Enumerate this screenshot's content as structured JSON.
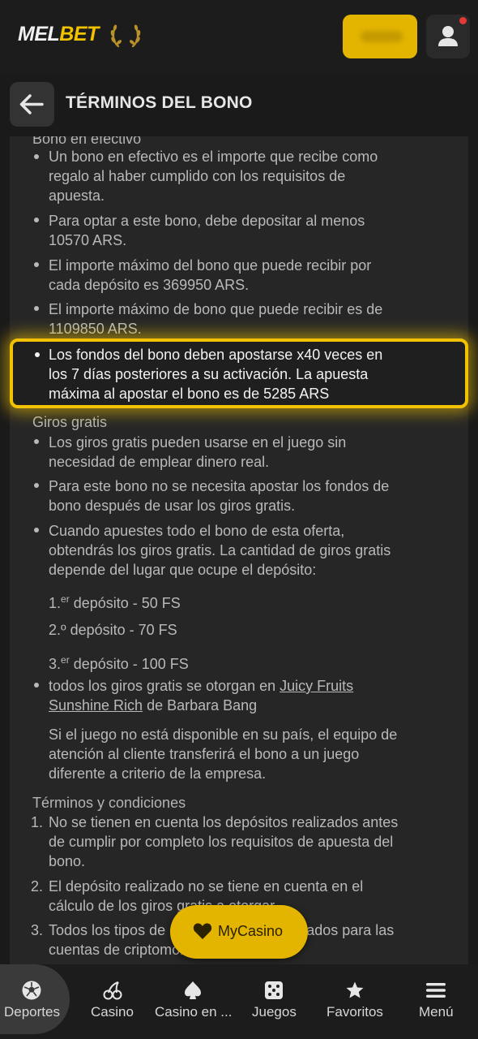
{
  "header": {
    "logo_mel": "MEL",
    "logo_bet": "BET"
  },
  "titlebar": {
    "title": "TÉRMINOS DEL BONO"
  },
  "content": {
    "cash_section_title": "Bono en efectivo",
    "cash_items": [
      [
        "Un bono en efectivo es el importe que recibe como",
        "regalo al haber cumplido con los requisitos de",
        "apuesta."
      ],
      [
        "Para optar a este bono, debe depositar al menos",
        "10570 ARS."
      ],
      [
        "El importe máximo del bono que puede recibir por",
        "cada depósito es 369950 ARS."
      ],
      [
        "El importe máximo de bono que puede recibir es de",
        "1109850 ARS."
      ]
    ],
    "highlight_lines": [
      "Los fondos del bono deben apostarse x40 veces en",
      "los 7 días posteriores a su activación. La apuesta",
      "máxima al apostar el bono es de 5285 ARS"
    ],
    "spins_section_title": "Giros gratis",
    "spins_items": [
      [
        "Los giros gratis pueden usarse en el juego sin",
        "necesidad de emplear dinero real."
      ],
      [
        "Para este bono no se necesita apostar los fondos de",
        "bono después de usar los giros gratis."
      ],
      [
        "Cuando apuestes todo el bono de esta oferta,",
        "obtendrás los giros gratis. La cantidad de giros gratis",
        "depende del lugar que ocupe el depósito:"
      ]
    ],
    "deposits": [
      {
        "num": "1.",
        "sup": "er",
        "text": " depósito - 50 FS"
      },
      {
        "num": "2.º",
        "sup": "",
        "text": " depósito - 70 FS"
      },
      {
        "num": "3.",
        "sup": "er",
        "text": " depósito - 100 FS"
      }
    ],
    "games_line_prefix": "todos los giros gratis se otorgan en ",
    "games_link_1": "Juicy Fruits",
    "games_link_2": "Sunshine Rich",
    "games_line_suffix": " de Barbara Bang",
    "availability_lines": [
      "Si el juego no está disponible en su país, el equipo de",
      "atención al cliente transferirá el bono a un juego",
      "diferente a criterio de la empresa."
    ],
    "terms_section_title": "Términos y condiciones",
    "terms_items": [
      {
        "n": "1.",
        "lines": [
          "No se tienen en cuenta los depósitos realizados antes",
          "de cumplir por completo los requisitos de apuesta del",
          "bono."
        ]
      },
      {
        "n": "2.",
        "lines": [
          "El depósito realizado no se tiene en cuenta en el",
          "cálculo de los giros gratis a otorgar."
        ]
      },
      {
        "n": "3.",
        "lines": [
          "Todos los tipos de depósito están habilitados para las",
          "cuentas de criptomonedas."
        ]
      }
    ]
  },
  "mycasino": {
    "label": "MyCasino"
  },
  "bottom_nav": {
    "items": [
      {
        "label": "Deportes",
        "icon": "soccer-ball-icon",
        "active": true
      },
      {
        "label": "Casino",
        "icon": "cherries-icon",
        "active": false
      },
      {
        "label": "Casino en ...",
        "icon": "spade-icon",
        "active": false
      },
      {
        "label": "Juegos",
        "icon": "dice-icon",
        "active": false
      },
      {
        "label": "Favoritos",
        "icon": "star-icon",
        "active": false
      },
      {
        "label": "Menú",
        "icon": "hamburger-icon",
        "active": false
      }
    ]
  },
  "colors": {
    "accent": "#e3b400",
    "background": "#262626",
    "header": "#1c1c1c"
  }
}
